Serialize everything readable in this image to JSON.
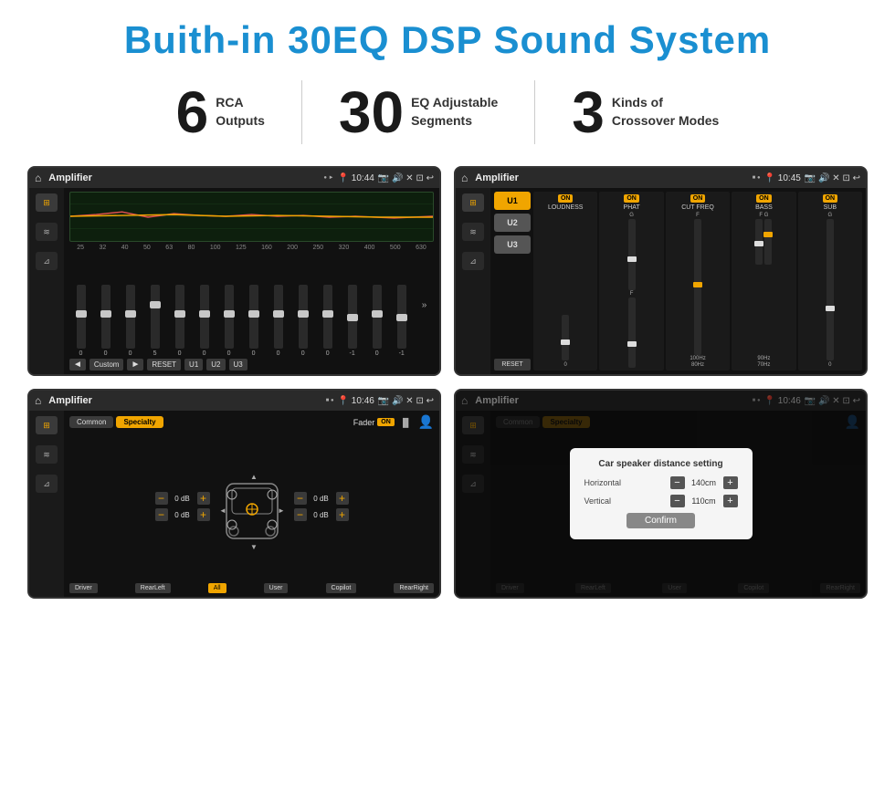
{
  "title": "Buith-in 30EQ DSP Sound System",
  "stats": [
    {
      "number": "6",
      "text": "RCA\nOutputs"
    },
    {
      "number": "30",
      "text": "EQ Adjustable\nSegments"
    },
    {
      "number": "3",
      "text": "Kinds of\nCrossover Modes"
    }
  ],
  "screens": [
    {
      "id": "eq-screen",
      "topbar": {
        "title": "Amplifier",
        "time": "10:44"
      },
      "type": "eq",
      "eq_labels": [
        "25",
        "32",
        "40",
        "50",
        "63",
        "80",
        "100",
        "125",
        "160",
        "200",
        "250",
        "320",
        "400",
        "500",
        "630"
      ],
      "eq_values": [
        "0",
        "0",
        "0",
        "5",
        "0",
        "0",
        "0",
        "0",
        "0",
        "0",
        "0",
        "-1",
        "0",
        "-1"
      ],
      "bottom_btns": [
        "Custom",
        "RESET",
        "U1",
        "U2",
        "U3"
      ]
    },
    {
      "id": "crossover-screen",
      "topbar": {
        "title": "Amplifier",
        "time": "10:45"
      },
      "type": "crossover",
      "u_btns": [
        "U1",
        "U2",
        "U3"
      ],
      "channels": [
        {
          "label": "LOUDNESS",
          "on": true
        },
        {
          "label": "PHAT",
          "on": true
        },
        {
          "label": "CUT FREQ",
          "on": true
        },
        {
          "label": "BASS",
          "on": true
        },
        {
          "label": "SUB",
          "on": true
        }
      ]
    },
    {
      "id": "fader-screen",
      "topbar": {
        "title": "Amplifier",
        "time": "10:46"
      },
      "type": "fader",
      "tabs": [
        "Common",
        "Specialty"
      ],
      "active_tab": "Specialty",
      "fader_label": "Fader",
      "on": true,
      "db_values": [
        "0 dB",
        "0 dB",
        "0 dB",
        "0 dB"
      ],
      "bottom_btns": [
        "Driver",
        "RearLeft",
        "All",
        "User",
        "Copilot",
        "RearRight"
      ]
    },
    {
      "id": "dialog-screen",
      "topbar": {
        "title": "Amplifier",
        "time": "10:46"
      },
      "type": "dialog",
      "tabs": [
        "Common",
        "Specialty"
      ],
      "dialog": {
        "title": "Car speaker distance setting",
        "horizontal_label": "Horizontal",
        "horizontal_value": "140cm",
        "vertical_label": "Vertical",
        "vertical_value": "110cm",
        "confirm_label": "Confirm"
      },
      "bottom_btns": [
        "Driver",
        "RearLeft",
        "User",
        "Copilot",
        "RearRight"
      ]
    }
  ],
  "icons": {
    "home": "⌂",
    "dot": "●",
    "play": "►",
    "back": "↩",
    "volume": "♪",
    "location": "📍",
    "settings": "⚙",
    "arrow_left": "◄",
    "arrow_right": "►",
    "eq_icon": "≡",
    "wave_icon": "≋",
    "speaker_icon": "⊿"
  }
}
